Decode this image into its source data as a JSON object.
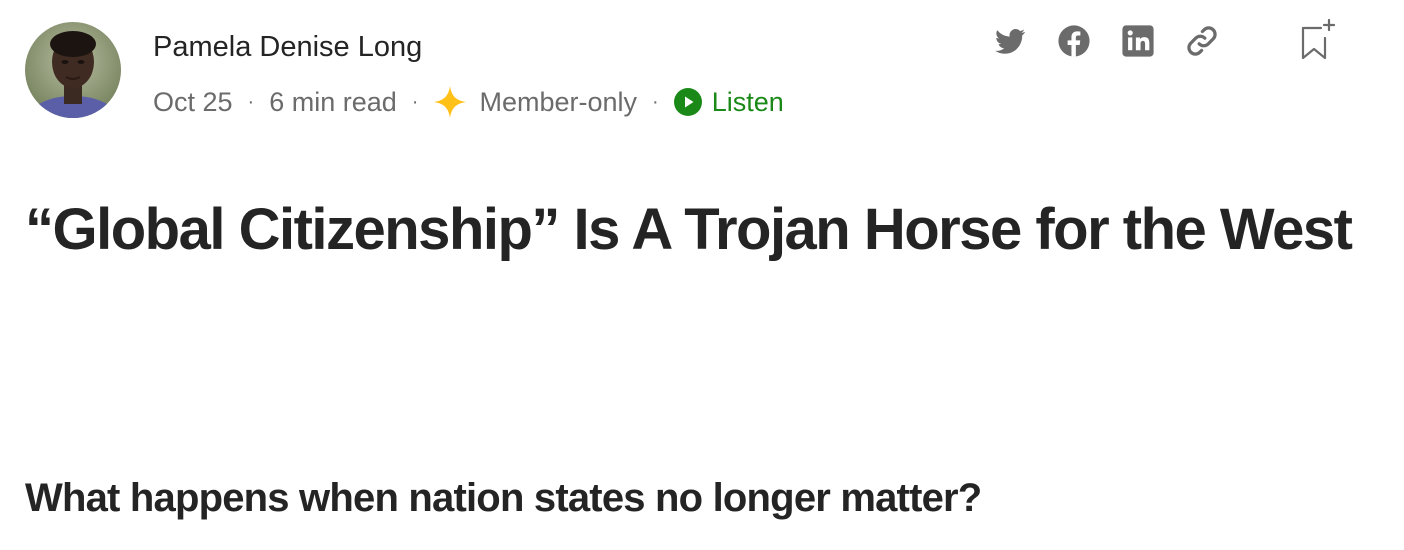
{
  "author": {
    "name": "Pamela Denise Long",
    "avatar_icon": "author-avatar-photo"
  },
  "meta": {
    "date": "Oct 25",
    "separator": "·",
    "read_time": "6 min read",
    "member_icon": "sparkle-star-icon",
    "member_label": "Member-only",
    "listen_icon": "play-circle-icon",
    "listen_label": "Listen"
  },
  "share": {
    "icons": [
      "twitter-icon",
      "facebook-icon",
      "linkedin-icon",
      "link-icon"
    ],
    "bookmark_icon": "bookmark-add-icon"
  },
  "article": {
    "title": "“Global Citizenship” Is A Trojan Horse for the West",
    "subtitle": "What happens when nation states no longer matter?"
  },
  "colors": {
    "text": "#242424",
    "muted": "#6b6b6b",
    "icon_gray": "#6b6b6b",
    "listen_green": "#1a8917",
    "member_star": "#ffc017"
  }
}
